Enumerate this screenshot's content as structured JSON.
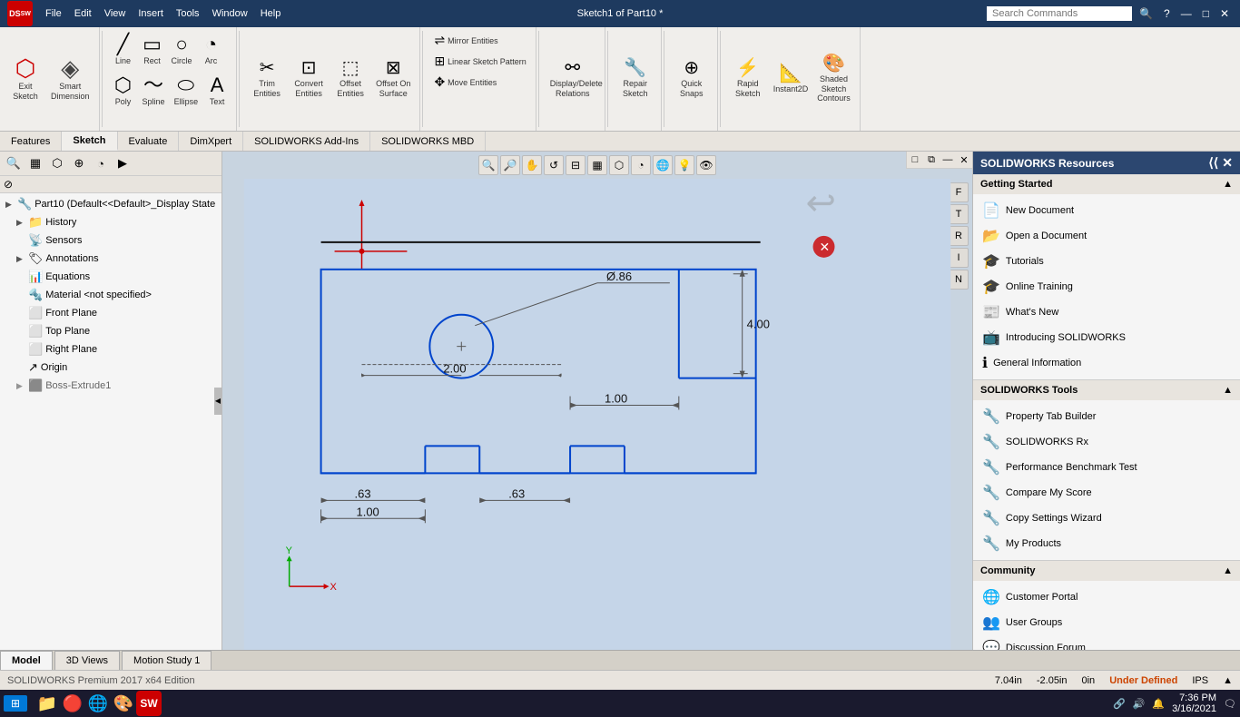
{
  "titlebar": {
    "logo": "SW",
    "menus": [
      "File",
      "Edit",
      "View",
      "Insert",
      "Tools",
      "Window",
      "Help"
    ],
    "title": "Sketch1 of Part10 *",
    "search_placeholder": "Search Commands",
    "controls": [
      "—",
      "□",
      "✕"
    ]
  },
  "ribbon": {
    "groups": [
      {
        "id": "exit-sketch-group",
        "items": [
          {
            "id": "exit-sketch",
            "icon": "⛶",
            "label": "Exit\nSketch",
            "large": true
          },
          {
            "id": "smart-dim",
            "icon": "◈",
            "label": "Smart\nDimension",
            "large": true
          }
        ]
      },
      {
        "id": "sketch-tools-group",
        "items": [
          {
            "id": "trim",
            "icon": "✂",
            "label": "Trim\nEntities"
          },
          {
            "id": "convert",
            "icon": "⊡",
            "label": "Convert\nEntities"
          },
          {
            "id": "offset",
            "icon": "⊟",
            "label": "Offset\nEntities"
          },
          {
            "id": "offset-surface",
            "icon": "⊠",
            "label": "Offset On\nSurface"
          }
        ]
      },
      {
        "id": "mirror-group",
        "items": [
          {
            "id": "mirror",
            "icon": "⇌",
            "label": "Mirror Entities"
          },
          {
            "id": "linear-pattern",
            "icon": "⊞",
            "label": "Linear Sketch Pattern"
          },
          {
            "id": "move",
            "icon": "✥",
            "label": "Move Entities"
          }
        ]
      },
      {
        "id": "relations-group",
        "items": [
          {
            "id": "display-delete",
            "icon": "⚯",
            "label": "Display/Delete\nRelations"
          }
        ]
      },
      {
        "id": "repair-group",
        "items": [
          {
            "id": "repair",
            "icon": "🔧",
            "label": "Repair\nSketch"
          }
        ]
      },
      {
        "id": "snaps-group",
        "items": [
          {
            "id": "quick-snaps",
            "icon": "⊕",
            "label": "Quick\nSnaps"
          }
        ]
      },
      {
        "id": "rapid-group",
        "items": [
          {
            "id": "rapid-sketch",
            "icon": "⚡",
            "label": "Rapid\nSketch"
          },
          {
            "id": "instant2d",
            "icon": "📐",
            "label": "Instant2D"
          },
          {
            "id": "shaded-contours",
            "icon": "🎨",
            "label": "Shaded\nSketch\nContours"
          }
        ]
      }
    ]
  },
  "tabs": {
    "items": [
      "Features",
      "Sketch",
      "Evaluate",
      "DimXpert",
      "SOLIDWORKS Add-Ins",
      "SOLIDWORKS MBD"
    ],
    "active": "Sketch"
  },
  "left_panel": {
    "toolbar_icons": [
      "⭕",
      "▦",
      "⬡",
      "⊕",
      "◔",
      "▶"
    ],
    "tree": [
      {
        "level": 0,
        "icon": "🔧",
        "label": "Part10  (Default<<Default>_Display State",
        "expand": "▶"
      },
      {
        "level": 1,
        "icon": "📁",
        "label": "History",
        "expand": "▶"
      },
      {
        "level": 1,
        "icon": "📡",
        "label": "Sensors",
        "expand": ""
      },
      {
        "level": 1,
        "icon": "🏷",
        "label": "Annotations",
        "expand": "▶"
      },
      {
        "level": 1,
        "icon": "📊",
        "label": "Equations",
        "expand": ""
      },
      {
        "level": 1,
        "icon": "🔩",
        "label": "Material <not specified>",
        "expand": ""
      },
      {
        "level": 1,
        "icon": "⬜",
        "label": "Front Plane",
        "expand": ""
      },
      {
        "level": 1,
        "icon": "⬜",
        "label": "Top Plane",
        "expand": ""
      },
      {
        "level": 1,
        "icon": "⬜",
        "label": "Right Plane",
        "expand": ""
      },
      {
        "level": 1,
        "icon": "↗",
        "label": "Origin",
        "expand": ""
      },
      {
        "level": 1,
        "icon": "⬛",
        "label": "Boss-Extrude1",
        "expand": "▶",
        "dimmed": true
      }
    ]
  },
  "viewport": {
    "sketch_values": {
      "dim1": "Ø.86",
      "dim2": "2.00",
      "dim3": "4.00",
      "dim4": "1.00",
      "dim5": ".63",
      "dim6": ".63",
      "dim7": "1.00"
    }
  },
  "right_panel": {
    "title": "SOLIDWORKS Resources",
    "sections": [
      {
        "id": "getting-started",
        "label": "Getting Started",
        "items": [
          {
            "id": "new-doc",
            "icon": "📄",
            "label": "New Document"
          },
          {
            "id": "open-doc",
            "icon": "📂",
            "label": "Open a Document"
          },
          {
            "id": "tutorials",
            "icon": "🎓",
            "label": "Tutorials"
          },
          {
            "id": "online-training",
            "icon": "🎓",
            "label": "Online Training"
          },
          {
            "id": "whats-new",
            "icon": "📰",
            "label": "What's New"
          },
          {
            "id": "introducing",
            "icon": "📺",
            "label": "Introducing SOLIDWORKS"
          },
          {
            "id": "general-info",
            "icon": "ℹ",
            "label": "General Information"
          }
        ]
      },
      {
        "id": "sw-tools",
        "label": "SOLIDWORKS Tools",
        "items": [
          {
            "id": "prop-tab",
            "icon": "🔧",
            "label": "Property Tab Builder"
          },
          {
            "id": "sw-rx",
            "icon": "🔧",
            "label": "SOLIDWORKS Rx"
          },
          {
            "id": "perf-bench",
            "icon": "🔧",
            "label": "Performance Benchmark Test"
          },
          {
            "id": "compare-score",
            "icon": "🔧",
            "label": "Compare My Score"
          },
          {
            "id": "copy-settings",
            "icon": "🔧",
            "label": "Copy Settings Wizard"
          },
          {
            "id": "my-products",
            "icon": "🔧",
            "label": "My Products"
          }
        ]
      },
      {
        "id": "community",
        "label": "Community",
        "items": [
          {
            "id": "customer-portal",
            "icon": "🌐",
            "label": "Customer Portal"
          },
          {
            "id": "user-groups",
            "icon": "👥",
            "label": "User Groups"
          },
          {
            "id": "discussion",
            "icon": "💬",
            "label": "Discussion Forum"
          }
        ]
      }
    ]
  },
  "status_bar": {
    "coords": [
      "7.04in",
      "-2.05in",
      "0in"
    ],
    "status": "Under Defined",
    "units": "IPS"
  },
  "bottom_tabs": {
    "items": [
      "Model",
      "3D Views",
      "Motion Study 1"
    ],
    "active": "Model"
  },
  "taskbar": {
    "edition": "SOLIDWORKS Premium 2017 x64 Edition",
    "time": "7:36 PM",
    "date": "3/16/2021",
    "icons": [
      "⊞",
      "📁",
      "🔴",
      "🌐",
      "🎨",
      "SW"
    ]
  }
}
